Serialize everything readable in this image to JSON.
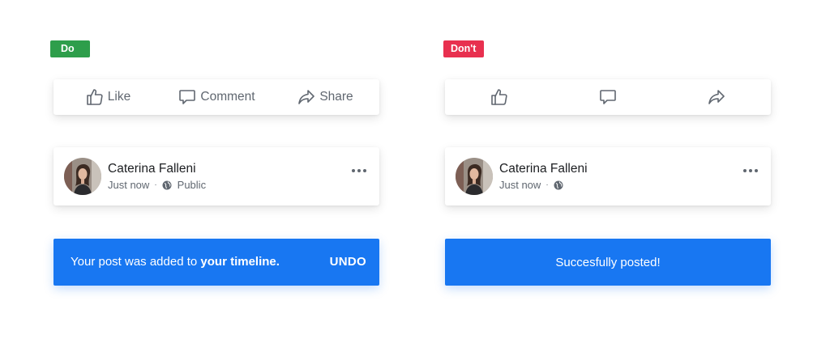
{
  "do_panel": {
    "badge": "Do",
    "actions": {
      "like": "Like",
      "comment": "Comment",
      "share": "Share"
    },
    "post": {
      "author": "Caterina Falleni",
      "time": "Just now",
      "separator": "·",
      "audience": "Public"
    },
    "snackbar": {
      "message_prefix": "Your post was added to ",
      "message_bold": "your timeline.",
      "action": "UNDO"
    }
  },
  "dont_panel": {
    "badge": "Don't",
    "post": {
      "author": "Caterina Falleni",
      "time": "Just now",
      "separator": "·"
    },
    "snackbar": {
      "message": "Succesfully posted!"
    }
  },
  "colors": {
    "do_badge": "#2e9e4b",
    "dont_badge": "#e8304f",
    "snackbar": "#1877f2",
    "icon_gray": "#606770"
  },
  "icons": [
    "like-icon",
    "comment-icon",
    "share-icon",
    "globe-icon",
    "more-icon"
  ]
}
